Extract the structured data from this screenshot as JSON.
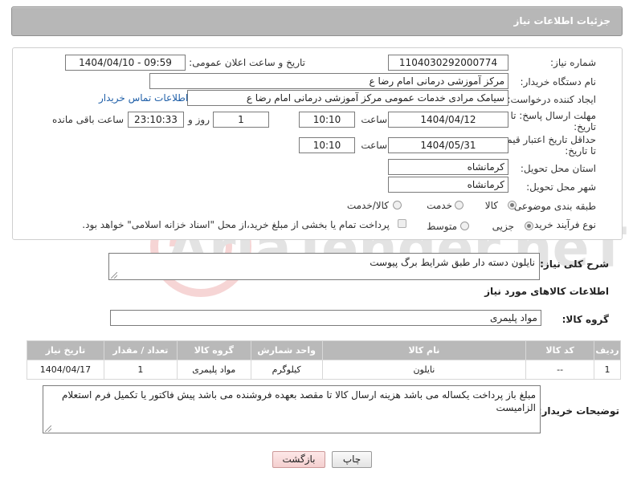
{
  "header": {
    "title": "جزئیات اطلاعات نیاز"
  },
  "fields": {
    "need_number_label": "شماره نیاز:",
    "need_number": "1104030292000774",
    "announce_label": "تاریخ و ساعت اعلان عمومی:",
    "announce_value": "1404/04/10 - 09:59",
    "buyer_label": "نام دستگاه خریدار:",
    "buyer_value": "مرکز آموزشی  درمانی امام رضا  ع",
    "creator_label": "ایجاد کننده درخواست:",
    "creator_value": "سیامک مرادی خدمات عمومی مرکز آموزشی  درمانی امام رضا  ع",
    "contact_link": "اطلاعات تماس خریدار",
    "deadline_label_1": "مهلت ارسال پاسخ: تا",
    "deadline_label_2": "تاریخ:",
    "deadline_date": "1404/04/12",
    "time_label": "ساعت",
    "deadline_time": "10:10",
    "days_value": "1",
    "days_label": "روز و",
    "remaining_time": "23:10:33",
    "remaining_label": "ساعت باقی مانده",
    "price_valid_label_1": "حداقل تاریخ اعتبار قیمت:",
    "price_valid_label_2": "تا تاریخ:",
    "price_valid_date": "1404/05/31",
    "price_valid_time": "10:10",
    "province_label": "استان محل تحویل:",
    "province_value": "کرمانشاه",
    "city_label": "شهر محل تحویل:",
    "city_value": "کرمانشاه",
    "category_label": "طبقه بندی موضوعی:",
    "category_options": [
      "کالا",
      "خدمت",
      "کالا/خدمت"
    ],
    "category_selected": "کالا",
    "process_label": "نوع فرآیند خرید :",
    "process_options": [
      "جزیی",
      "متوسط"
    ],
    "process_selected": "جزیی",
    "payment_note": "پرداخت تمام یا بخشی از مبلغ خرید،از محل \"اسناد خزانه اسلامی\" خواهد بود."
  },
  "description": {
    "label": "شرح کلی نیاز:",
    "value": "نایلون دسته دار طبق شرایط برگ پیوست"
  },
  "goods": {
    "section_title": "اطلاعات کالاهای مورد نیاز",
    "group_label": "گروه کالا:",
    "group_value": "مواد پلیمری",
    "columns": [
      "ردیف",
      "کد کالا",
      "نام کالا",
      "واحد شمارش",
      "گروه کالا",
      "تعداد / مقدار",
      "تاریخ نیاز"
    ],
    "rows": [
      [
        "1",
        "--",
        "نایلون",
        "کیلوگرم",
        "مواد پلیمری",
        "1",
        "1404/04/17"
      ]
    ]
  },
  "buyer_notes": {
    "label": "توضیحات خریدار:",
    "value": "مبلغ باز پرداخت یکساله می باشد هزینه ارسال کالا تا مقصد بعهده فروشنده می باشد پیش فاکتور یا تکمیل فرم استعلام الزامیست"
  },
  "buttons": {
    "print": "چاپ",
    "back": "بازگشت"
  },
  "watermark": {
    "text": "AriaTender.neT"
  },
  "colors": {
    "header_bg": "#b7b7b7",
    "link": "#1f5fa8",
    "table_header": "#b9b9b9"
  }
}
